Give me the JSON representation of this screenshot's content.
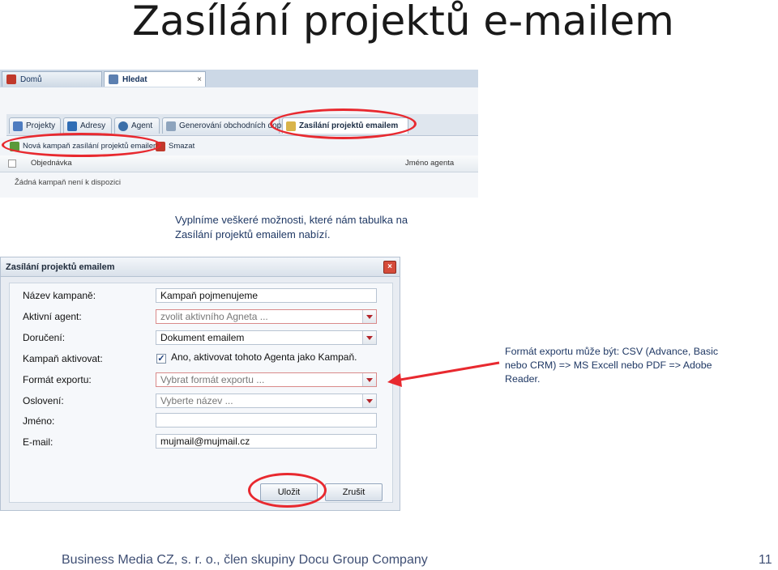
{
  "slide": {
    "title": "Zasílání projektů e-mailem",
    "caption": "Vyplníme veškeré možnosti, které nám tabulka na Zasílání projektů emailem nabízí.",
    "note": "Formát exportu může být: CSV (Advance, Basic nebo CRM) => MS Excell nebo PDF => Adobe Reader.",
    "footer": "Business Media CZ, s. r. o., člen skupiny Docu Group Company",
    "page_number": "11"
  },
  "app": {
    "tabs": [
      {
        "label": "Domů",
        "icon": "home-icon"
      },
      {
        "label": "Hledat",
        "icon": "search-icon",
        "close": "×"
      }
    ],
    "modules": [
      {
        "label": "Projekty",
        "icon": "projects-icon"
      },
      {
        "label": "Adresy",
        "icon": "addresses-icon"
      },
      {
        "label": "Agent",
        "icon": "agent-icon"
      },
      {
        "label": "Generování obchodních dopisů",
        "icon": "letters-icon"
      },
      {
        "label": "Zasílání projektů emailem",
        "icon": "email-projects-icon"
      }
    ],
    "actions": [
      {
        "label": "Nová kampaň zasílání projektů emailem",
        "icon": "new-campaign-icon"
      },
      {
        "label": "Smazat",
        "icon": "delete-icon"
      }
    ],
    "table": {
      "columns": [
        "Objednávka",
        "Jméno agenta"
      ],
      "empty_message": "Žádná kampaň není k dispozici"
    }
  },
  "dialog": {
    "title": "Zasílání projektů emailem",
    "close": "×",
    "fields": {
      "campaign_name": {
        "label": "Název kampaně:",
        "value": "Kampaň pojmenujeme"
      },
      "active_agent": {
        "label": "Aktivní agent:",
        "value": "zvolit aktivního Agneta ..."
      },
      "delivery": {
        "label": "Doručení:",
        "value": "Dokument emailem"
      },
      "activate": {
        "label": "Kampaň aktivovat:",
        "checkbox_label": "Ano, aktivovat tohoto Agenta jako Kampaň.",
        "checked": "✓"
      },
      "export_format": {
        "label": "Formát exportu:",
        "value": "Vybrat formát exportu ..."
      },
      "salutation": {
        "label": "Oslovení:",
        "value": "Vyberte název ..."
      },
      "name": {
        "label": "Jméno:",
        "value": ""
      },
      "email": {
        "label": "E-mail:",
        "value": "mujmail@mujmail.cz"
      }
    },
    "buttons": {
      "save": "Uložit",
      "cancel": "Zrušit"
    }
  },
  "colors": {
    "annotation": "#e8292f",
    "text_blue": "#1f3864"
  }
}
